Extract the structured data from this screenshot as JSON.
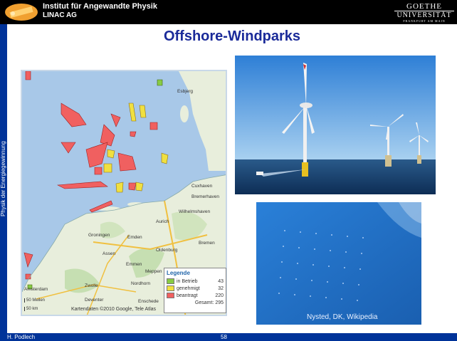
{
  "header": {
    "institute": "Institut für Angewandte Physik",
    "subtitle": "LINAC AG",
    "university_line1": "GOETHE",
    "university_line2": "UNIVERSITÄT",
    "university_line3": "FRANKFURT AM MAIN"
  },
  "sidebar": {
    "text": "Physik der Energiegewinnung"
  },
  "slide": {
    "title": "Offshore-Windparks"
  },
  "map": {
    "places": [
      "Esbjerg",
      "Cuxhaven",
      "Bremerhaven",
      "Wilhelmshaven",
      "Bremen",
      "Groningen",
      "Emden",
      "Aurich",
      "Oldenburg",
      "Assen",
      "Emmen",
      "Nordhorn",
      "Enschede",
      "Meppen",
      "Amsterdam",
      "Zwolle",
      "Deventer"
    ],
    "legend": {
      "title": "Legende",
      "items": [
        {
          "label": "in Betrieb",
          "count": "43",
          "color": "#88cc44"
        },
        {
          "label": "genehmigt",
          "count": "32",
          "color": "#f0e040"
        },
        {
          "label": "beantragt",
          "count": "220",
          "color": "#f06060"
        }
      ],
      "total_label": "Gesamt:",
      "total_count": "295"
    },
    "scale1": "50 Meilen",
    "scale2": "50 km",
    "attribution": "Kartendaten ©2010 Google, Tele Atlas"
  },
  "photo": {
    "caption": "Nysted, DK, Wikipedia"
  },
  "footer": {
    "author": "H. Podlech",
    "page": "58"
  }
}
